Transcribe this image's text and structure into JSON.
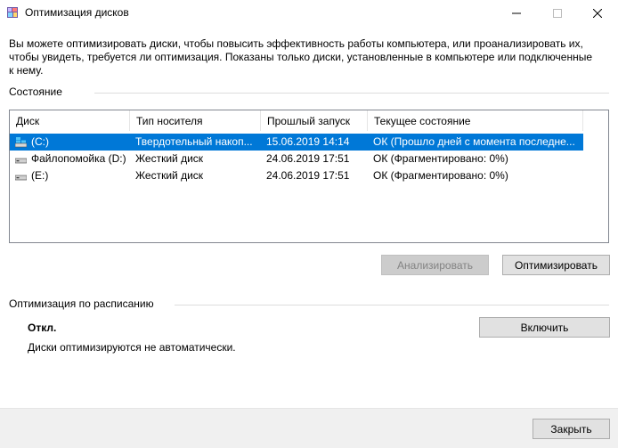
{
  "window": {
    "title": "Оптимизация дисков",
    "icon": "defrag-app-icon"
  },
  "description": "Вы можете оптимизировать диски, чтобы повысить эффективность работы  компьютера, или проанализировать их, чтобы увидеть, требуется ли оптимизация. Показаны только диски, установленные в компьютере или подключенные к нему.",
  "status_section": {
    "label": "Состояние",
    "columns": [
      "Диск",
      "Тип носителя",
      "Прошлый запуск",
      "Текущее состояние"
    ],
    "rows": [
      {
        "drive": "(C:)",
        "media": "Твердотельный накоп...",
        "last_run": "15.06.2019 14:14",
        "status": "ОК (Прошло дней с момента последне...",
        "icon": "system-drive-icon",
        "selected": true
      },
      {
        "drive": "Файлопомойка (D:)",
        "media": "Жесткий диск",
        "last_run": "24.06.2019 17:51",
        "status": "ОК (Фрагментировано: 0%)",
        "icon": "hard-drive-icon",
        "selected": false
      },
      {
        "drive": "(E:)",
        "media": "Жесткий диск",
        "last_run": "24.06.2019 17:51",
        "status": "ОК (Фрагментировано: 0%)",
        "icon": "hard-drive-icon",
        "selected": false
      }
    ],
    "analyze_label": "Анализировать",
    "optimize_label": "Оптимизировать"
  },
  "schedule_section": {
    "label": "Оптимизация по расписанию",
    "status": "Откл.",
    "description": "Диски оптимизируются не автоматически.",
    "enable_label": "Включить"
  },
  "footer": {
    "close_label": "Закрыть"
  },
  "colors": {
    "selection": "#0078d7",
    "button_face": "#e1e1e1",
    "footer_bg": "#f0f0f0"
  }
}
